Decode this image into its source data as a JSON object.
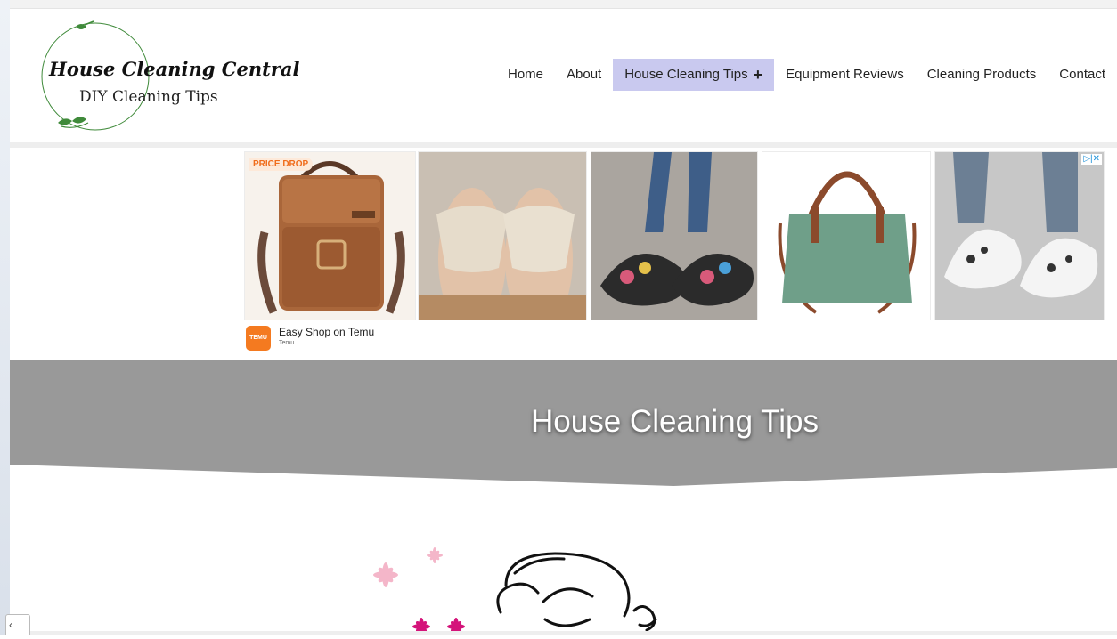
{
  "logo": {
    "title": "House Cleaning Central",
    "subtitle": "DIY Cleaning Tips",
    "accent_color": "#3f8a3a"
  },
  "nav": {
    "items": [
      {
        "label": "Home"
      },
      {
        "label": "About"
      },
      {
        "label": "House Cleaning Tips",
        "active": true,
        "icon": "plus-icon"
      },
      {
        "label": "Equipment Reviews"
      },
      {
        "label": "Cleaning Products"
      },
      {
        "label": "Contact"
      }
    ],
    "active_color": "#c9c9ef"
  },
  "ad": {
    "badge": "PRICE DROP",
    "advertiser": "Easy Shop on Temu",
    "source": "Temu",
    "brand_logo_text": "TEMU",
    "adchoices_icon": "adchoices-icon",
    "products": [
      "leather-crossbody-bag",
      "beige-sandals",
      "floral-flat-shoes",
      "green-handbag",
      "leopard-sneakers"
    ]
  },
  "banner": {
    "title": "House Cleaning Tips",
    "color": "#999999"
  }
}
